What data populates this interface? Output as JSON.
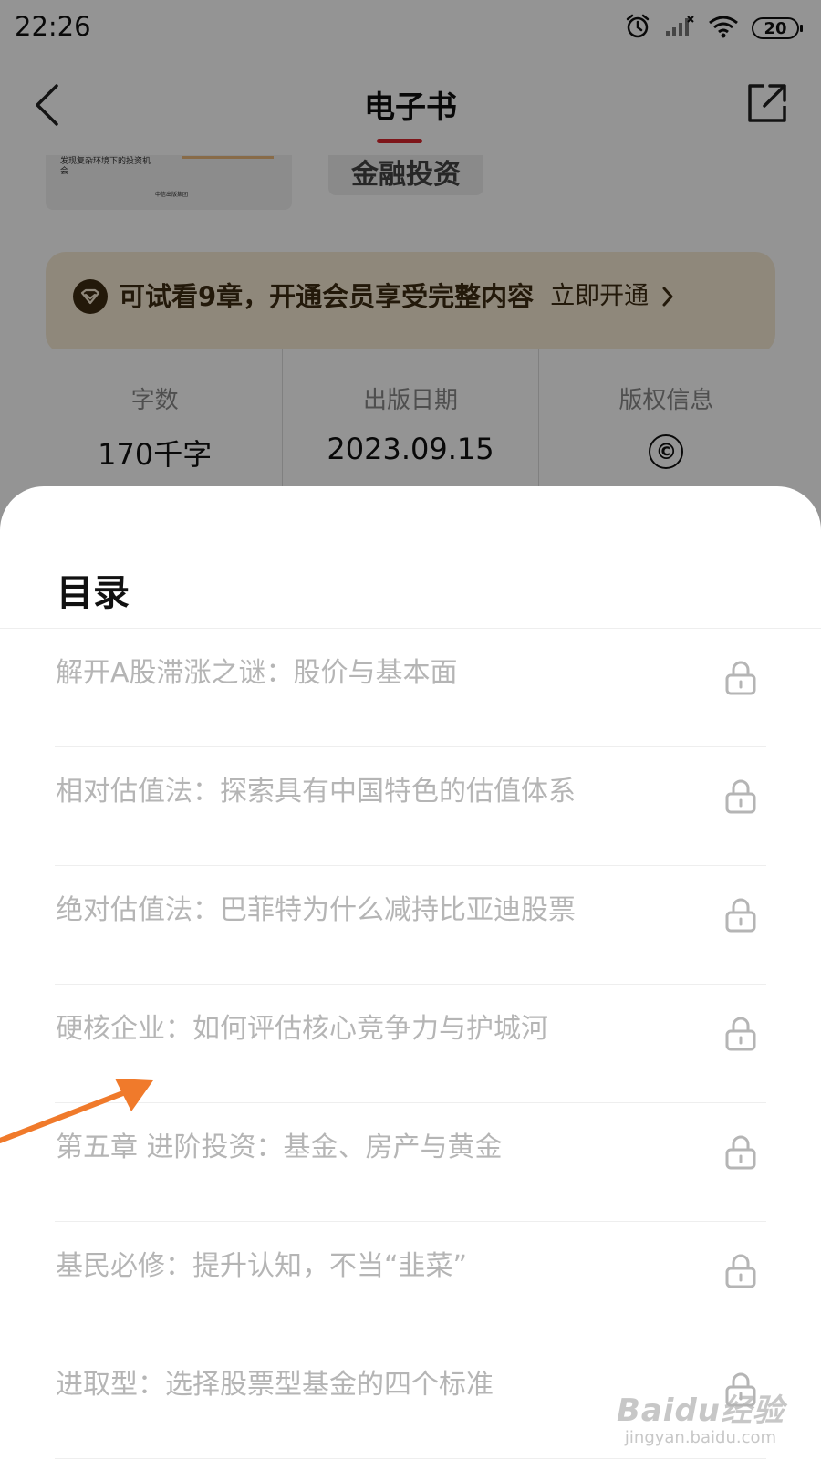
{
  "status_bar": {
    "time": "22:26",
    "battery": "20",
    "icons": [
      "alarm-icon",
      "signal-icon",
      "wifi-icon",
      "battery-icon"
    ]
  },
  "header": {
    "title": "电子书",
    "accent_color": "#d9262d"
  },
  "book_preview": {
    "cover_text": "发现复杂环境下的投资机会",
    "cover_publisher": "中信出版集团",
    "tag": "金融投资"
  },
  "vip_banner": {
    "text": "可试看9章，开通会员享受完整内容",
    "action": "立即开通"
  },
  "book_info": [
    {
      "label": "字数",
      "value": "170千字"
    },
    {
      "label": "出版日期",
      "value": "2023.09.15"
    },
    {
      "label": "版权信息",
      "value": "©"
    }
  ],
  "toc": {
    "title": "目录",
    "chapters": [
      {
        "title": "解开A股滞涨之谜：股价与基本面",
        "locked": true
      },
      {
        "title": "相对估值法：探索具有中国特色的估值体系",
        "locked": true
      },
      {
        "title": "绝对估值法：巴菲特为什么减持比亚迪股票",
        "locked": true
      },
      {
        "title": "硬核企业：如何评估核心竞争力与护城河",
        "locked": true
      },
      {
        "title": "第五章 进阶投资：基金、房产与黄金",
        "locked": true
      },
      {
        "title": "基民必修：提升认知，不当“韭菜”",
        "locked": true
      },
      {
        "title": "进取型：选择股票型基金的四个标准",
        "locked": true
      }
    ]
  },
  "watermark": {
    "logo": "Baidu经验",
    "url": "jingyan.baidu.com"
  },
  "colors": {
    "locked_text": "#b5b5b5",
    "vip_background": "#f6ead4",
    "vip_text": "#3d2b12",
    "annotation_arrow": "#f07a2b"
  }
}
